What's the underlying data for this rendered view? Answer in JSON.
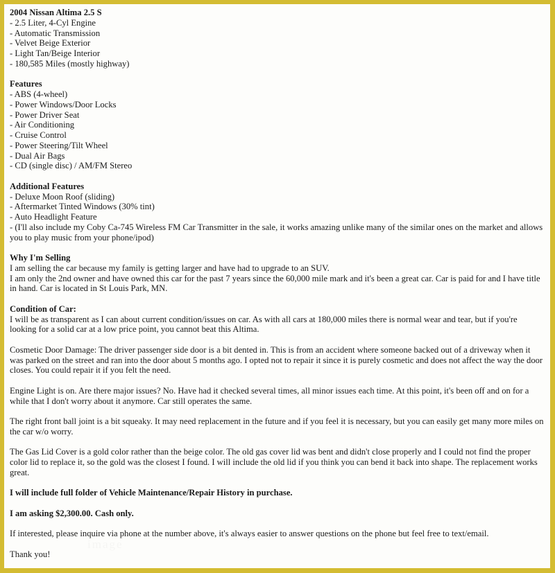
{
  "document": {
    "kind": "vehicle-sale-listing",
    "border_color": "#d4bc32",
    "background_color": "#fdfdfb",
    "text_color": "#1b1b1b"
  },
  "title": "2004 Nissan Altima 2.5 S",
  "spec_lines": [
    "- 2.5 Liter, 4-Cyl Engine",
    "- Automatic Transmission",
    "- Velvet Beige Exterior",
    "- Light Tan/Beige Interior",
    "- 180,585 Miles (mostly highway)"
  ],
  "features": {
    "heading": "Features",
    "items": [
      "- ABS (4-wheel)",
      "- Power Windows/Door Locks",
      "- Power Driver Seat",
      "- Air Conditioning",
      "- Cruise Control",
      "- Power Steering/Tilt Wheel",
      "- Dual Air Bags",
      "- CD (single disc) / AM/FM Stereo"
    ]
  },
  "additional_features": {
    "heading": "Additional Features",
    "items": [
      "- Deluxe Moon Roof (sliding)",
      "- Aftermarket Tinted Windows (30% tint)",
      "- Auto Headlight Feature"
    ],
    "transmitter_note": "- (I'll also include my Coby Ca-745 Wireless FM Car Transmitter in the sale, it works amazing unlike many of the similar ones on the market and allows you to play music from your phone/ipod)"
  },
  "why_selling": {
    "heading": "Why I'm Selling",
    "line1": "I am selling the car because my family is getting larger and have had to upgrade to an SUV.",
    "line2": "I am only the 2nd owner and have owned this car for the past 7 years since the 60,000 mile mark and it's been a great car. Car is paid for and I have title in hand. Car is located in St Louis Park, MN."
  },
  "condition": {
    "heading": "Condition of Car:",
    "intro": "I will be as transparent as I can about current condition/issues on car. As with all cars at 180,000 miles there is normal wear and tear, but if you're looking for a solid car at a low price point, you cannot beat this Altima.",
    "door_damage": "Cosmetic Door Damage: The driver passenger side door is a bit dented in. This is from an accident where someone backed out of a driveway when it was parked on the street and ran into the door about 5 months ago. I opted not to repair it since it is purely cosmetic and does not affect the way the door closes. You could repair it if you felt the need.",
    "engine_light": "Engine Light is on. Are there major issues? No. Have had it checked several times, all minor issues each time. At this point, it's been off and on for a while that I don't worry about it anymore. Car still operates the same.",
    "ball_joint": "The right front ball joint is a bit squeaky. It may need replacement in the future and if you feel it is necessary, but you can easily get many more miles on the car w/o worry.",
    "gas_lid": "The Gas Lid Cover is a gold color rather than the beige color. The old gas cover lid was bent and didn't close properly and I could not find the proper color lid to replace it, so the gold was the closest I found. I will include the old lid if you think you can bend it back into shape. The replacement works great."
  },
  "closing": {
    "maintenance_records": "I will include full folder of Vehicle Maintenance/Repair History in purchase.",
    "price_line": "I am asking $2,300.00. Cash only.",
    "contact_line": "If interested, please inquire via phone at the number above, it's always easier to answer questions on the phone but feel free to text/email.",
    "sign_off": "Thank you!"
  },
  "watermark": {
    "text": "image"
  }
}
